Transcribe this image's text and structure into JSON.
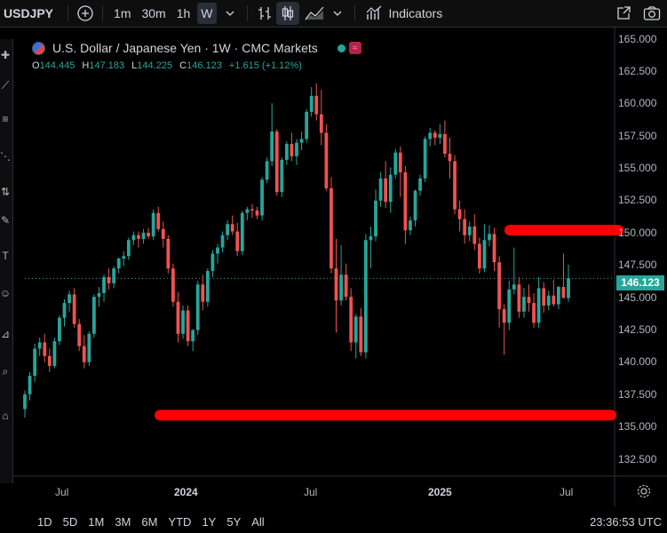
{
  "topbar": {
    "symbol": "USDJPY",
    "intervals": [
      "1m",
      "30m",
      "1h",
      "W"
    ],
    "active_interval": "W",
    "indicators_label": "Indicators"
  },
  "legend": {
    "title": "U.S. Dollar / Japanese Yen · 1W · CMC Markets",
    "open_label": "O",
    "open": "144.445",
    "high_label": "H",
    "high": "147.183",
    "low_label": "L",
    "low": "144.225",
    "close_label": "C",
    "close": "146.123",
    "change": "+1.615 (+1.12%)"
  },
  "price_axis": {
    "ticks": [
      "165.000",
      "162.500",
      "160.000",
      "157.500",
      "155.000",
      "152.500",
      "150.000",
      "147.500",
      "145.000",
      "142.500",
      "140.000",
      "137.500",
      "135.000",
      "132.500"
    ],
    "current_price": "146.123"
  },
  "time_axis": {
    "labels": [
      "Jul",
      "2024",
      "Jul",
      "2025",
      "Jul"
    ]
  },
  "bottombar": {
    "ranges": [
      "1D",
      "5D",
      "1M",
      "3M",
      "6M",
      "YTD",
      "1Y",
      "5Y",
      "All"
    ],
    "clock": "23:36:53 UTC"
  },
  "colors": {
    "up": "#26a69a",
    "down": "#ef5350",
    "marker": "#ff0000",
    "background": "#000000"
  },
  "chart_data": {
    "type": "candlestick",
    "interval": "1W",
    "ylim": [
      131.5,
      165.5
    ],
    "up_color": "#26a69a",
    "down_color": "#ef5350",
    "candles": [
      [
        135.5,
        137.0,
        134.8,
        136.7
      ],
      [
        136.7,
        138.5,
        136.2,
        138.2
      ],
      [
        138.2,
        140.8,
        137.7,
        140.4
      ],
      [
        140.4,
        141.3,
        139.8,
        140.9
      ],
      [
        140.9,
        141.6,
        139.3,
        139.8
      ],
      [
        139.8,
        140.4,
        138.5,
        139.0
      ],
      [
        139.0,
        141.3,
        138.8,
        141.0
      ],
      [
        141.0,
        143.1,
        140.7,
        142.9
      ],
      [
        142.9,
        144.4,
        142.2,
        144.1
      ],
      [
        144.1,
        145.1,
        143.4,
        144.8
      ],
      [
        144.8,
        145.3,
        142.1,
        142.4
      ],
      [
        142.4,
        142.8,
        140.2,
        140.6
      ],
      [
        140.6,
        141.5,
        138.8,
        139.3
      ],
      [
        139.3,
        141.8,
        139.0,
        141.6
      ],
      [
        141.6,
        144.8,
        141.3,
        144.6
      ],
      [
        144.6,
        145.4,
        143.8,
        144.9
      ],
      [
        144.9,
        146.4,
        144.2,
        146.2
      ],
      [
        146.2,
        146.9,
        145.2,
        145.7
      ],
      [
        145.7,
        147.1,
        145.3,
        146.9
      ],
      [
        146.9,
        147.8,
        146.5,
        147.7
      ],
      [
        147.7,
        148.3,
        147.1,
        147.9
      ],
      [
        147.9,
        149.4,
        147.6,
        149.2
      ],
      [
        149.2,
        149.9,
        148.8,
        149.6
      ],
      [
        149.6,
        149.9,
        148.6,
        149.3
      ],
      [
        149.3,
        150.1,
        148.9,
        149.8
      ],
      [
        149.8,
        150.2,
        149.3,
        149.5
      ],
      [
        149.5,
        151.7,
        149.2,
        151.4
      ],
      [
        151.4,
        151.9,
        149.9,
        150.1
      ],
      [
        150.1,
        150.7,
        148.6,
        149.3
      ],
      [
        149.3,
        149.6,
        146.5,
        146.9
      ],
      [
        146.9,
        147.3,
        143.8,
        144.2
      ],
      [
        144.2,
        145.0,
        140.9,
        141.6
      ],
      [
        141.6,
        143.9,
        141.2,
        143.5
      ],
      [
        143.5,
        143.9,
        140.6,
        141.0
      ],
      [
        141.0,
        142.0,
        140.2,
        141.9
      ],
      [
        141.9,
        145.9,
        141.5,
        145.6
      ],
      [
        145.6,
        146.4,
        143.5,
        144.2
      ],
      [
        144.2,
        146.9,
        143.8,
        146.7
      ],
      [
        146.7,
        148.4,
        146.2,
        148.1
      ],
      [
        148.1,
        148.9,
        147.3,
        148.6
      ],
      [
        148.6,
        149.9,
        148.2,
        149.6
      ],
      [
        149.6,
        150.8,
        149.2,
        150.5
      ],
      [
        150.5,
        151.2,
        149.6,
        149.9
      ],
      [
        149.9,
        150.6,
        147.9,
        148.3
      ],
      [
        148.3,
        151.6,
        148.0,
        151.4
      ],
      [
        151.4,
        151.9,
        150.8,
        151.7
      ],
      [
        151.7,
        152.1,
        151.0,
        151.6
      ],
      [
        151.6,
        151.9,
        150.9,
        151.2
      ],
      [
        151.2,
        154.3,
        150.8,
        154.1
      ],
      [
        154.1,
        155.9,
        153.8,
        155.6
      ],
      [
        155.6,
        160.3,
        155.2,
        158.0
      ],
      [
        158.0,
        158.2,
        152.8,
        153.1
      ],
      [
        153.1,
        155.9,
        152.7,
        155.7
      ],
      [
        155.7,
        157.2,
        155.3,
        157.0
      ],
      [
        157.0,
        157.9,
        155.6,
        156.0
      ],
      [
        156.0,
        157.4,
        155.3,
        157.1
      ],
      [
        157.1,
        158.0,
        156.5,
        157.4
      ],
      [
        157.4,
        159.8,
        157.1,
        159.6
      ],
      [
        159.6,
        161.6,
        159.2,
        160.9
      ],
      [
        160.9,
        161.9,
        158.9,
        159.4
      ],
      [
        159.4,
        161.4,
        156.9,
        157.9
      ],
      [
        157.9,
        158.6,
        153.2,
        153.4
      ],
      [
        153.4,
        154.3,
        146.5,
        146.9
      ],
      [
        146.9,
        149.3,
        141.7,
        144.3
      ],
      [
        144.3,
        148.8,
        143.9,
        146.4
      ],
      [
        146.4,
        147.3,
        144.3,
        144.6
      ],
      [
        144.6,
        145.3,
        140.2,
        140.9
      ],
      [
        140.9,
        143.2,
        139.6,
        143.0
      ],
      [
        143.0,
        143.7,
        139.8,
        140.1
      ],
      [
        140.1,
        149.7,
        139.6,
        149.2
      ],
      [
        149.2,
        150.3,
        146.9,
        149.5
      ],
      [
        149.5,
        153.3,
        149.1,
        152.4
      ],
      [
        152.4,
        154.7,
        151.9,
        154.2
      ],
      [
        154.2,
        155.6,
        151.8,
        152.3
      ],
      [
        152.3,
        155.1,
        151.4,
        154.5
      ],
      [
        154.5,
        156.6,
        154.2,
        156.3
      ],
      [
        156.3,
        156.8,
        152.7,
        154.7
      ],
      [
        154.7,
        155.2,
        148.9,
        150.0
      ],
      [
        150.0,
        151.1,
        149.6,
        150.8
      ],
      [
        150.8,
        153.3,
        150.3,
        153.2
      ],
      [
        153.2,
        154.5,
        152.8,
        154.2
      ],
      [
        154.2,
        157.6,
        153.9,
        157.4
      ],
      [
        157.4,
        158.3,
        156.8,
        157.9
      ],
      [
        157.9,
        158.1,
        156.9,
        157.5
      ],
      [
        157.5,
        158.6,
        157.0,
        157.8
      ],
      [
        157.8,
        158.9,
        155.9,
        156.2
      ],
      [
        156.2,
        157.5,
        154.2,
        155.6
      ],
      [
        155.6,
        156.1,
        151.3,
        151.7
      ],
      [
        151.7,
        152.4,
        149.9,
        150.9
      ],
      [
        150.9,
        151.7,
        148.9,
        149.6
      ],
      [
        149.6,
        150.7,
        149.1,
        150.3
      ],
      [
        150.3,
        151.3,
        148.4,
        148.9
      ],
      [
        148.9,
        149.4,
        146.5,
        146.9
      ],
      [
        146.9,
        150.5,
        146.6,
        149.2
      ],
      [
        149.2,
        150.4,
        148.7,
        149.7
      ],
      [
        149.7,
        150.2,
        146.7,
        147.4
      ],
      [
        147.4,
        147.9,
        142.1,
        143.6
      ],
      [
        143.6,
        144.0,
        139.9,
        142.5
      ],
      [
        142.5,
        145.9,
        141.9,
        145.2
      ],
      [
        145.2,
        148.6,
        144.8,
        145.6
      ],
      [
        145.6,
        146.2,
        142.9,
        143.4
      ],
      [
        143.4,
        145.3,
        142.9,
        144.6
      ],
      [
        144.6,
        145.6,
        143.4,
        144.1
      ],
      [
        144.1,
        144.9,
        142.1,
        142.5
      ],
      [
        142.5,
        146.2,
        142.1,
        145.3
      ],
      [
        145.3,
        145.8,
        143.3,
        143.9
      ],
      [
        143.9,
        145.1,
        143.5,
        144.7
      ],
      [
        144.7,
        146.0,
        143.8,
        144.0
      ],
      [
        144.0,
        145.5,
        143.6,
        145.4
      ],
      [
        145.4,
        148.1,
        144.8,
        144.5
      ],
      [
        144.5,
        147.2,
        144.2,
        146.1
      ]
    ],
    "horizontal_markers": [
      {
        "price": 135.0,
        "color": "#ff0000"
      },
      {
        "price": 150.0,
        "color": "#ff0000"
      }
    ]
  }
}
